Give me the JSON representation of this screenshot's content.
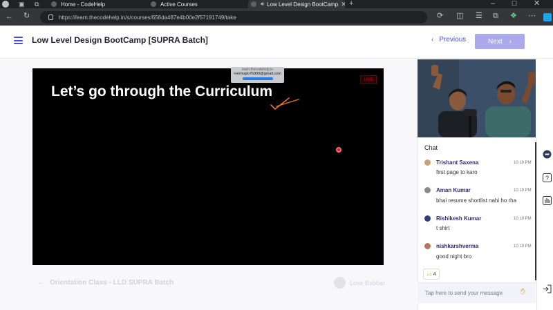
{
  "browser": {
    "tabs": [
      {
        "label": "Home - CodeHelp"
      },
      {
        "label": "Active Courses"
      },
      {
        "label": "Low Level Design BootCamp"
      }
    ],
    "url": "https://learn.thecodehelp.in/s/courses/656da487e4b00e2f57191749/take"
  },
  "header": {
    "title": "Low Level Design BootCamp [SUPRA Batch]",
    "prev_label": "Previous",
    "next_label": "Next"
  },
  "video": {
    "heading": "Let’s go through the Curriculum",
    "live_badge": "LIVE",
    "watermark_domain": "learn.thecodehelp.in",
    "watermark_email": "rvermajio76300@gmail.com"
  },
  "lesson_nav": {
    "previous_lesson": "Orientation Class - LLD SUPRA Batch",
    "instructor": "Love Babbar"
  },
  "chat": {
    "title": "Chat",
    "messages": [
      {
        "name": "Trishant Saxena",
        "time": "10:19 PM",
        "text": "first page to karo",
        "avatar_color": "#c9a27a"
      },
      {
        "name": "Aman Kumar",
        "time": "10:19 PM",
        "text": "bhai resume shortlist nahi ho rha",
        "avatar_color": "#8c8c8c"
      },
      {
        "name": "Rishikesh Kumar",
        "time": "10:19 PM",
        "text": "t shirt",
        "avatar_color": "#2f3f7a"
      },
      {
        "name": "nishkarshverma",
        "time": "10:19 PM",
        "text": "good night bro",
        "avatar_color": "#b07a5a"
      }
    ],
    "reaction_count": "4",
    "input_placeholder": "Tap here to send your message"
  },
  "colors": {
    "accent": "#4b4bd1",
    "next_button_disabled": "#a9a9ec",
    "chat_name": "#2b2b6b"
  }
}
